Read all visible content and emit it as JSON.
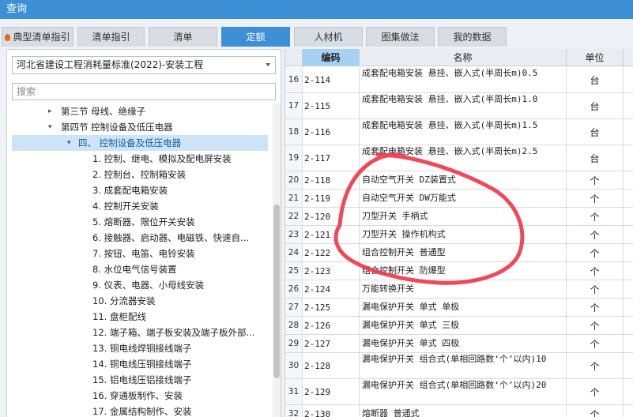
{
  "window": {
    "title": "查询"
  },
  "tabs": [
    {
      "label": "典型清单指引",
      "active": false
    },
    {
      "label": "清单指引",
      "active": false
    },
    {
      "label": "清单",
      "active": false
    },
    {
      "label": "定额",
      "active": true
    },
    {
      "label": "人材机",
      "active": false
    },
    {
      "label": "图集做法",
      "active": false
    },
    {
      "label": "我的数据",
      "active": false
    }
  ],
  "left": {
    "library": "河北省建设工程消耗量标准(2022)-安装工程",
    "search_placeholder": "搜索",
    "tree": [
      {
        "label": "第三节 母线、绝缘子",
        "level": 1,
        "caret": "▸"
      },
      {
        "label": "第四节 控制设备及低压电器",
        "level": 1,
        "caret": "▾"
      },
      {
        "label": "四、 控制设备及低压电器",
        "level": 2,
        "caret": "▾",
        "selected": true
      },
      {
        "label": "1. 控制、继电、模拟及配电屏安装",
        "level": 3
      },
      {
        "label": "2. 控制台、控制箱安装",
        "level": 3
      },
      {
        "label": "3. 成套配电箱安装",
        "level": 3
      },
      {
        "label": "4. 控制开关安装",
        "level": 3
      },
      {
        "label": "5. 熔断器、限位开关安装",
        "level": 3
      },
      {
        "label": "6. 接触器、启动器、电磁铁、快速自...",
        "level": 3
      },
      {
        "label": "7. 按钮、电笛、电铃安装",
        "level": 3
      },
      {
        "label": "8. 水位电气信号装置",
        "level": 3
      },
      {
        "label": "9. 仪表、电器、小母线安装",
        "level": 3
      },
      {
        "label": "10. 分流器安装",
        "level": 3
      },
      {
        "label": "11. 盘柜配线",
        "level": 3
      },
      {
        "label": "12. 端子箱、端子板安装及端子板外部...",
        "level": 3
      },
      {
        "label": "13. 铜电线焊铜接线端子",
        "level": 3
      },
      {
        "label": "14. 铜电线压铜接线端子",
        "level": 3
      },
      {
        "label": "15. 铝电线压铝接线端子",
        "level": 3
      },
      {
        "label": "16. 穿通板制作、安装",
        "level": 3
      },
      {
        "label": "17. 金属结构制作、安装",
        "level": 3
      }
    ]
  },
  "grid": {
    "headers": {
      "code": "编码",
      "name": "名称",
      "unit": "单位"
    },
    "rows": [
      {
        "idx": "16",
        "code": "2-114",
        "name": "成套配电箱安装 悬挂、嵌入式(半周长m)0.5",
        "unit": "台",
        "tall": true
      },
      {
        "idx": "17",
        "code": "2-115",
        "name": "成套配电箱安装 悬挂、嵌入式(半周长m)1.0",
        "unit": "台",
        "tall": true
      },
      {
        "idx": "18",
        "code": "2-116",
        "name": "成套配电箱安装 悬挂、嵌入式(半周长m)1.5",
        "unit": "台",
        "tall": true
      },
      {
        "idx": "19",
        "code": "2-117",
        "name": "成套配电箱安装 悬挂、嵌入式(半周长m)2.5",
        "unit": "台",
        "tall": true
      },
      {
        "idx": "20",
        "code": "2-118",
        "name": "自动空气开关 DZ装置式",
        "unit": "个",
        "tall": false
      },
      {
        "idx": "21",
        "code": "2-119",
        "name": "自动空气开关 DW万能式",
        "unit": "个",
        "tall": false
      },
      {
        "idx": "22",
        "code": "2-120",
        "name": "刀型开关 手柄式",
        "unit": "个",
        "tall": false
      },
      {
        "idx": "23",
        "code": "2-121",
        "name": "刀型开关 操作机构式",
        "unit": "个",
        "tall": false
      },
      {
        "idx": "24",
        "code": "2-122",
        "name": "组合控制开关 普通型",
        "unit": "个",
        "tall": false
      },
      {
        "idx": "25",
        "code": "2-123",
        "name": "组合控制开关 防爆型",
        "unit": "个",
        "tall": false
      },
      {
        "idx": "26",
        "code": "2-124",
        "name": "万能转换开关",
        "unit": "个",
        "tall": false
      },
      {
        "idx": "27",
        "code": "2-125",
        "name": "漏电保护开关 单式 单极",
        "unit": "个",
        "tall": false
      },
      {
        "idx": "28",
        "code": "2-126",
        "name": "漏电保护开关 单式 三极",
        "unit": "个",
        "tall": false
      },
      {
        "idx": "29",
        "code": "2-127",
        "name": "漏电保护开关 单式 四极",
        "unit": "个",
        "tall": false
      },
      {
        "idx": "30",
        "code": "2-128",
        "name": "漏电保护开关 组合式(单相回路数‘个’以内)10",
        "unit": "个",
        "tall": true
      },
      {
        "idx": "31",
        "code": "2-129",
        "name": "漏电保护开关 组合式(单相回路数‘个’以内)20",
        "unit": "个",
        "tall": true
      },
      {
        "idx": "32",
        "code": "2-130",
        "name": "熔断器 普通式",
        "unit": "个",
        "tall": false
      }
    ]
  },
  "colors": {
    "accent": "#3d8fd6",
    "selected_bg": "#cde4f7",
    "code_header": "#a7d1f2",
    "annotation": "#ee3a4e"
  }
}
